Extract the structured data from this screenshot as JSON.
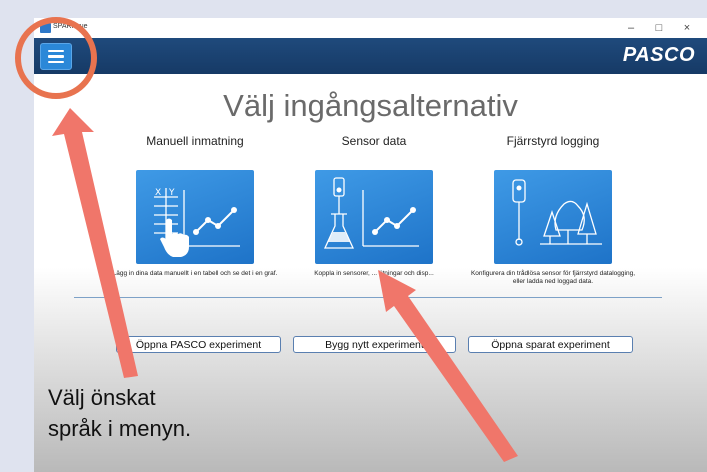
{
  "window": {
    "app_title": "SPARKvue",
    "minimize": "–",
    "maximize": "□",
    "close": "×"
  },
  "header": {
    "brand": "PASCO"
  },
  "main": {
    "title": "Välj ingångsalternativ",
    "options": [
      {
        "label": "Manuell inmatning",
        "description": "Lägg in dina data manuellt i en tabell och se det i en graf."
      },
      {
        "label": "Sensor data",
        "description": "Koppla in sensorer, ... ätningar och disp..."
      },
      {
        "label": "Fjärrstyrd logging",
        "description": "Konfigurera din trådlösa sensor för fjärrstyrd datalogging, eller ladda ned loggad data."
      }
    ],
    "actions": {
      "open_pasco": "Öppna PASCO experiment",
      "build_new": "Bygg nytt experiment",
      "open_saved": "Öppna sparat experiment"
    }
  },
  "annotation": {
    "line1": "Välj önskat",
    "line2": "språk i menyn.",
    "highlight_color": "#e8734f",
    "arrow_color": "#f0766a"
  },
  "colors": {
    "appbar": "#1b416f",
    "tile": "#2e86d8",
    "menu_button": "#2b88d8"
  }
}
